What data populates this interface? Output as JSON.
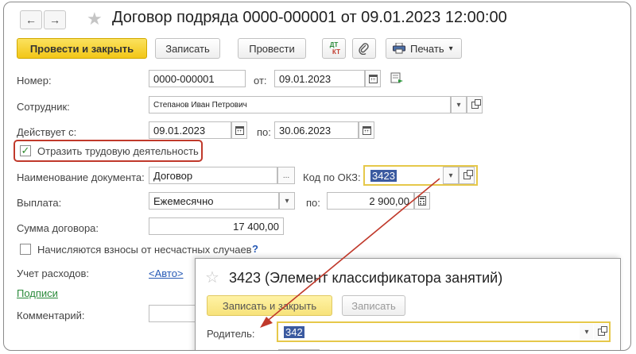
{
  "window": {
    "title": "Договор подряда 0000-000001 от 09.01.2023 12:00:00",
    "back_icon": "←",
    "forward_icon": "→",
    "favorite_icon": "★"
  },
  "toolbar": {
    "post_close_label": "Провести и закрыть",
    "save_label": "Записать",
    "post_label": "Провести",
    "dtkt_top": "ДТ",
    "dtkt_bottom": "КТ",
    "print_label": "Печать",
    "dropdown_arrow": "▾"
  },
  "form": {
    "number": {
      "label": "Номер:",
      "value": "0000-000001",
      "from_label": "от:",
      "date": "09.01.2023"
    },
    "employee": {
      "label": "Сотрудник:",
      "value": "Степанов Иван Петрович"
    },
    "valid": {
      "label": "Действует с:",
      "from": "09.01.2023",
      "to_label": "по:",
      "to": "30.06.2023"
    },
    "labor_activity": {
      "label": "Отразить трудовую деятельность",
      "checked": true,
      "check_mark": "✓"
    },
    "doc_name": {
      "label": "Наименование документа:",
      "value": "Договор",
      "select_glyph": "...",
      "okz_label": "Код по ОКЗ:",
      "okz_value": "3423"
    },
    "payment": {
      "label": "Выплата:",
      "value": "Ежемесячно",
      "to_label": "по:",
      "amount": "2 900,00"
    },
    "contract_sum": {
      "label": "Сумма договора:",
      "value": "17 400,00"
    },
    "accident_fees": {
      "label": "Начисляются взносы от несчастных случаев",
      "checked": false,
      "help": "?"
    },
    "expenses": {
      "label": "Учет расходов:",
      "value": "<Авто>"
    },
    "signatures_link": "Подписи",
    "comment": {
      "label": "Комментарий:",
      "value": ""
    }
  },
  "popup": {
    "title": "3423 (Элемент классификатора занятий)",
    "save_close_label": "Записать и закрыть",
    "save_label": "Записать",
    "parent_label": "Родитель:",
    "parent_value": "342"
  },
  "colors": {
    "primary_button": "#f2c617",
    "highlight_red": "#c0392b",
    "okz_border": "#e6c84a",
    "arrow": "#c0392b",
    "selection": "#3b5aa0",
    "link": "#2659b5"
  }
}
